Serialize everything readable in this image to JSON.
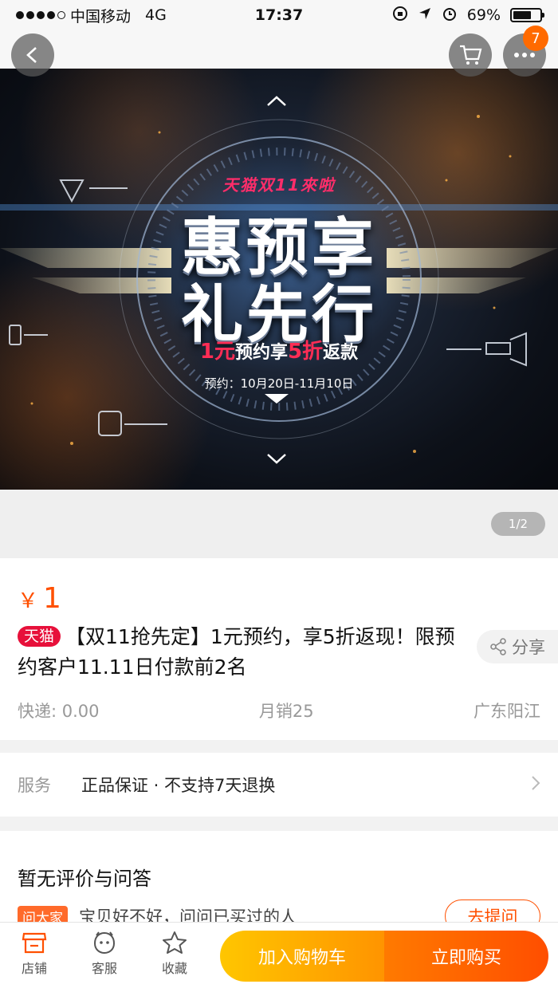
{
  "status_bar": {
    "carrier": "中国移动",
    "network": "4G",
    "time": "17:37",
    "battery_percent": "69%",
    "battery_level": 0.69
  },
  "header": {
    "back_icon": "chevron-left-icon",
    "cart_icon": "cart-icon",
    "more_icon": "more-dots-icon",
    "notification_count": "7"
  },
  "banner": {
    "tag": "天猫双11來啦",
    "line1": "惠预享",
    "line2": "礼先行",
    "sub_amount": "1元",
    "sub_middle": "预约享",
    "sub_discount": "5折",
    "sub_end": "返款",
    "date": "预约：10月20日-11月10日",
    "pager": "1/2"
  },
  "product": {
    "currency": "￥",
    "price": "1",
    "badge": "天猫",
    "title": "【双11抢先定】1元预约，享5折返现！限预约客户11.11日付款前2名",
    "share_label": "分享",
    "shipping": "快递: 0.00",
    "monthly_sales": "月销25",
    "location": "广东阳江"
  },
  "service": {
    "label": "服务",
    "value": "正品保证 · 不支持7天退换"
  },
  "reviews": {
    "heading": "暂无评价与问答",
    "ask_tag": "问大家",
    "ask_text": "宝贝好不好，问问已买过的人",
    "ask_button": "去提问"
  },
  "bottom_bar": {
    "store": "店铺",
    "customer_service": "客服",
    "favorite": "收藏",
    "add_to_cart": "加入购物车",
    "buy_now": "立即购买"
  },
  "colors": {
    "accent": "#ff5000",
    "tmall_red": "#e7103a",
    "cart_gradient_start": "#ffc600",
    "buy_gradient_end": "#ff4e00"
  }
}
